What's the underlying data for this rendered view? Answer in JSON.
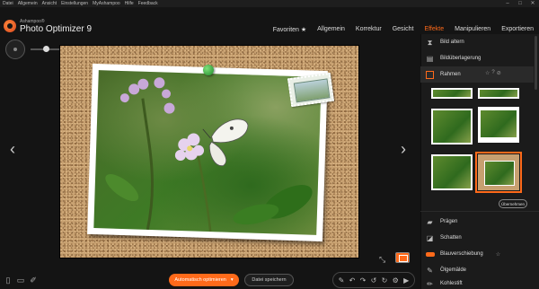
{
  "menu": {
    "items": [
      "Datei",
      "Allgemein",
      "Ansicht",
      "Einstellungen",
      "MyAshampoo",
      "Hilfe",
      "Feedback"
    ],
    "controls": [
      "–",
      "□",
      "✕"
    ]
  },
  "app": {
    "brand_small": "Ashampoo®",
    "title": "Photo Optimizer 9"
  },
  "nav": {
    "tabs": [
      {
        "label": "Favoriten ★",
        "active": false
      },
      {
        "label": "Allgemein",
        "active": false
      },
      {
        "label": "Korrektur",
        "active": false
      },
      {
        "label": "Gesicht",
        "active": false
      },
      {
        "label": "Effekte",
        "active": true
      },
      {
        "label": "Manipulieren",
        "active": false
      },
      {
        "label": "Exportieren",
        "active": false
      }
    ],
    "accent": "#ff6a1a"
  },
  "viewer": {
    "prev_arrow": "‹",
    "next_arrow": "›"
  },
  "panel": {
    "items_top": [
      {
        "label": "Bild altern",
        "icon": "hourglass-icon"
      },
      {
        "label": "Bildüberlagerung",
        "icon": "layers-icon"
      },
      {
        "label": "Rahmen",
        "icon": "frame-icon"
      }
    ],
    "rahmen_actions": [
      "☆",
      "?",
      "⊘"
    ],
    "apply_label": "Übernehmen",
    "items_bottom": [
      {
        "label": "Prägen",
        "icon": "emboss-icon"
      },
      {
        "label": "Schatten",
        "icon": "shadow-icon"
      },
      {
        "label": "Blauverschiebung",
        "icon": "blueshift-icon"
      },
      {
        "label": "Ölgemälde",
        "icon": "brush-icon"
      },
      {
        "label": "Kohlestift",
        "icon": "pencil-icon"
      }
    ],
    "favorite_star": "☆"
  },
  "bottom": {
    "auto_optimize_label": "Automatisch optimieren",
    "auto_dropdown": "▾",
    "save_label": "Datei speichern",
    "tools": [
      "✎",
      "↶",
      "↷",
      "↺",
      "↻",
      "⚙",
      "▶"
    ]
  }
}
